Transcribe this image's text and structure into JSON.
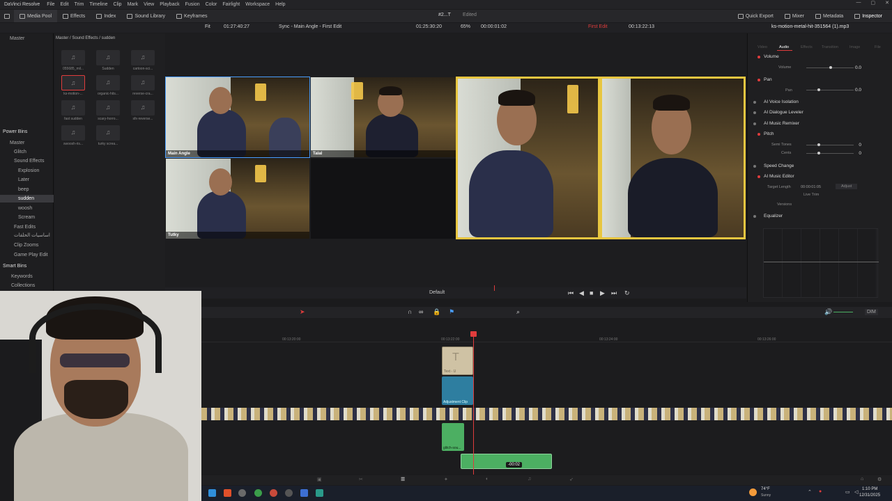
{
  "app": {
    "name": "DaVinci Resolve",
    "menu": [
      "File",
      "Edit",
      "Trim",
      "Timeline",
      "Clip",
      "Mark",
      "View",
      "Playback",
      "Fusion",
      "Color",
      "Fairlight",
      "Workspace",
      "Help"
    ],
    "project_title": "#2...T",
    "project_status": "Edited"
  },
  "toolbar": {
    "media_pool": "Media Pool",
    "effects": "Effects",
    "index": "Index",
    "sound_library": "Sound Library",
    "keyframes": "Keyframes",
    "quick_export": "Quick Export",
    "mixer": "Mixer",
    "metadata": "Metadata",
    "inspector": "Inspector"
  },
  "viewer_bar": {
    "fit": "Fit",
    "source_tc": "01:27:40:27",
    "viewer_title": "Sync - Main Angle - First Edit",
    "record_tc": "01:25:30:20",
    "zoom": "65%",
    "duration": "00:00:01:02",
    "timeline_name": "First Edit",
    "timeline_tc": "00:13:22:13",
    "clip_name": "ks-motion-metal-hit-351564 (1).mp3"
  },
  "left_panel": {
    "master": "Master",
    "power_bins": "Power Bins",
    "pb_master": "Master",
    "pb_items": [
      "Glitch",
      "Sound Effects",
      "Explosion",
      "Later",
      "beep",
      "sudden",
      "woosh",
      "Scream",
      "Fast Edits",
      "اساسيات الحلقات",
      "Clip Zooms",
      "Game Play Edit"
    ],
    "smart_bins": "Smart Bins",
    "sb_items": [
      "Keywords",
      "Collections"
    ]
  },
  "media_pool": {
    "breadcrumb": "Master / Sound Effects / sudden",
    "items": [
      "055685_mil...",
      "Sudden",
      "cartoon-sci...",
      "ks-motion-...",
      "organic-hits...",
      "reverse-cra...",
      "fast sudden",
      "scary-horro...",
      "sfx-reverse...",
      "swoosh-ris...",
      "turky screa..."
    ]
  },
  "viewer": {
    "angles": [
      "Main Angle",
      "Talal",
      "Tutky"
    ]
  },
  "inspector": {
    "tabs": [
      "Video",
      "Audio",
      "Effects",
      "Transition",
      "Image",
      "File"
    ],
    "volume": "Volume",
    "volume_label": "Volume",
    "volume_val": "0.0",
    "pan": "Pan",
    "pan_label": "Pan",
    "pan_val": "0.0",
    "ai_voice": "AI Voice Isolation",
    "ai_dialogue": "AI Dialogue Leveler",
    "ai_music_remixer": "AI Music Remixer",
    "pitch": "Pitch",
    "semi_tones": "Semi Tones",
    "semi_val": "0",
    "cents": "Cents",
    "cents_val": "0",
    "speed_change": "Speed Change",
    "ai_music_editor": "AI Music Editor",
    "target_length": "Target Length",
    "target_val": "00:00:01:05",
    "adjust": "Adjust",
    "live_trim": "Live Trim",
    "versions": "Versions",
    "equalizer": "Equalizer"
  },
  "timeline": {
    "default_label": "Default",
    "ticks": [
      "00:13:20:00",
      "00:13:22:00",
      "00:13:24:00",
      "00:13:26:00"
    ],
    "clips": {
      "text": "Text - U",
      "adjust": "Adjustment Clip",
      "glitch": "glitch-sou...",
      "drag_time": "-00:02"
    },
    "dim": "DIM"
  },
  "taskbar": {
    "weather_temp": "74°F",
    "weather_desc": "Sunny",
    "time": "1:10 PM",
    "date": "12/31/2025"
  },
  "colors": {
    "accent_red": "#e03c3c",
    "selection_blue": "#4a9eff",
    "audio_green": "#4caf62",
    "adjust_teal": "#2e7ea0"
  }
}
